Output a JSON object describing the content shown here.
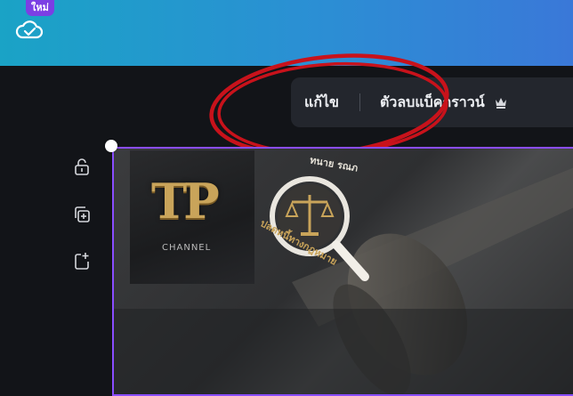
{
  "header": {
    "badge_new": "ใหม่",
    "cloud_icon": "cloud-check-icon",
    "gradient_colors": [
      "#1aa3c6",
      "#3a78d8"
    ]
  },
  "context_toolbar": {
    "edit_label": "แก้ไข",
    "bg_remover_label": "ตัวลบแบ็คกราวน์",
    "premium_icon": "crown-icon"
  },
  "side_actions": {
    "icons": [
      "lock-icon",
      "duplicate-icon",
      "add-page-icon"
    ]
  },
  "canvas": {
    "logo_text": "TP",
    "logo_sub": "CHANNEL",
    "seal_text_top": "ทนาย รณภ",
    "seal_text_bottom": "ปลดหนี้ทางกฎหมาย",
    "selection_color": "#8a4dff"
  }
}
